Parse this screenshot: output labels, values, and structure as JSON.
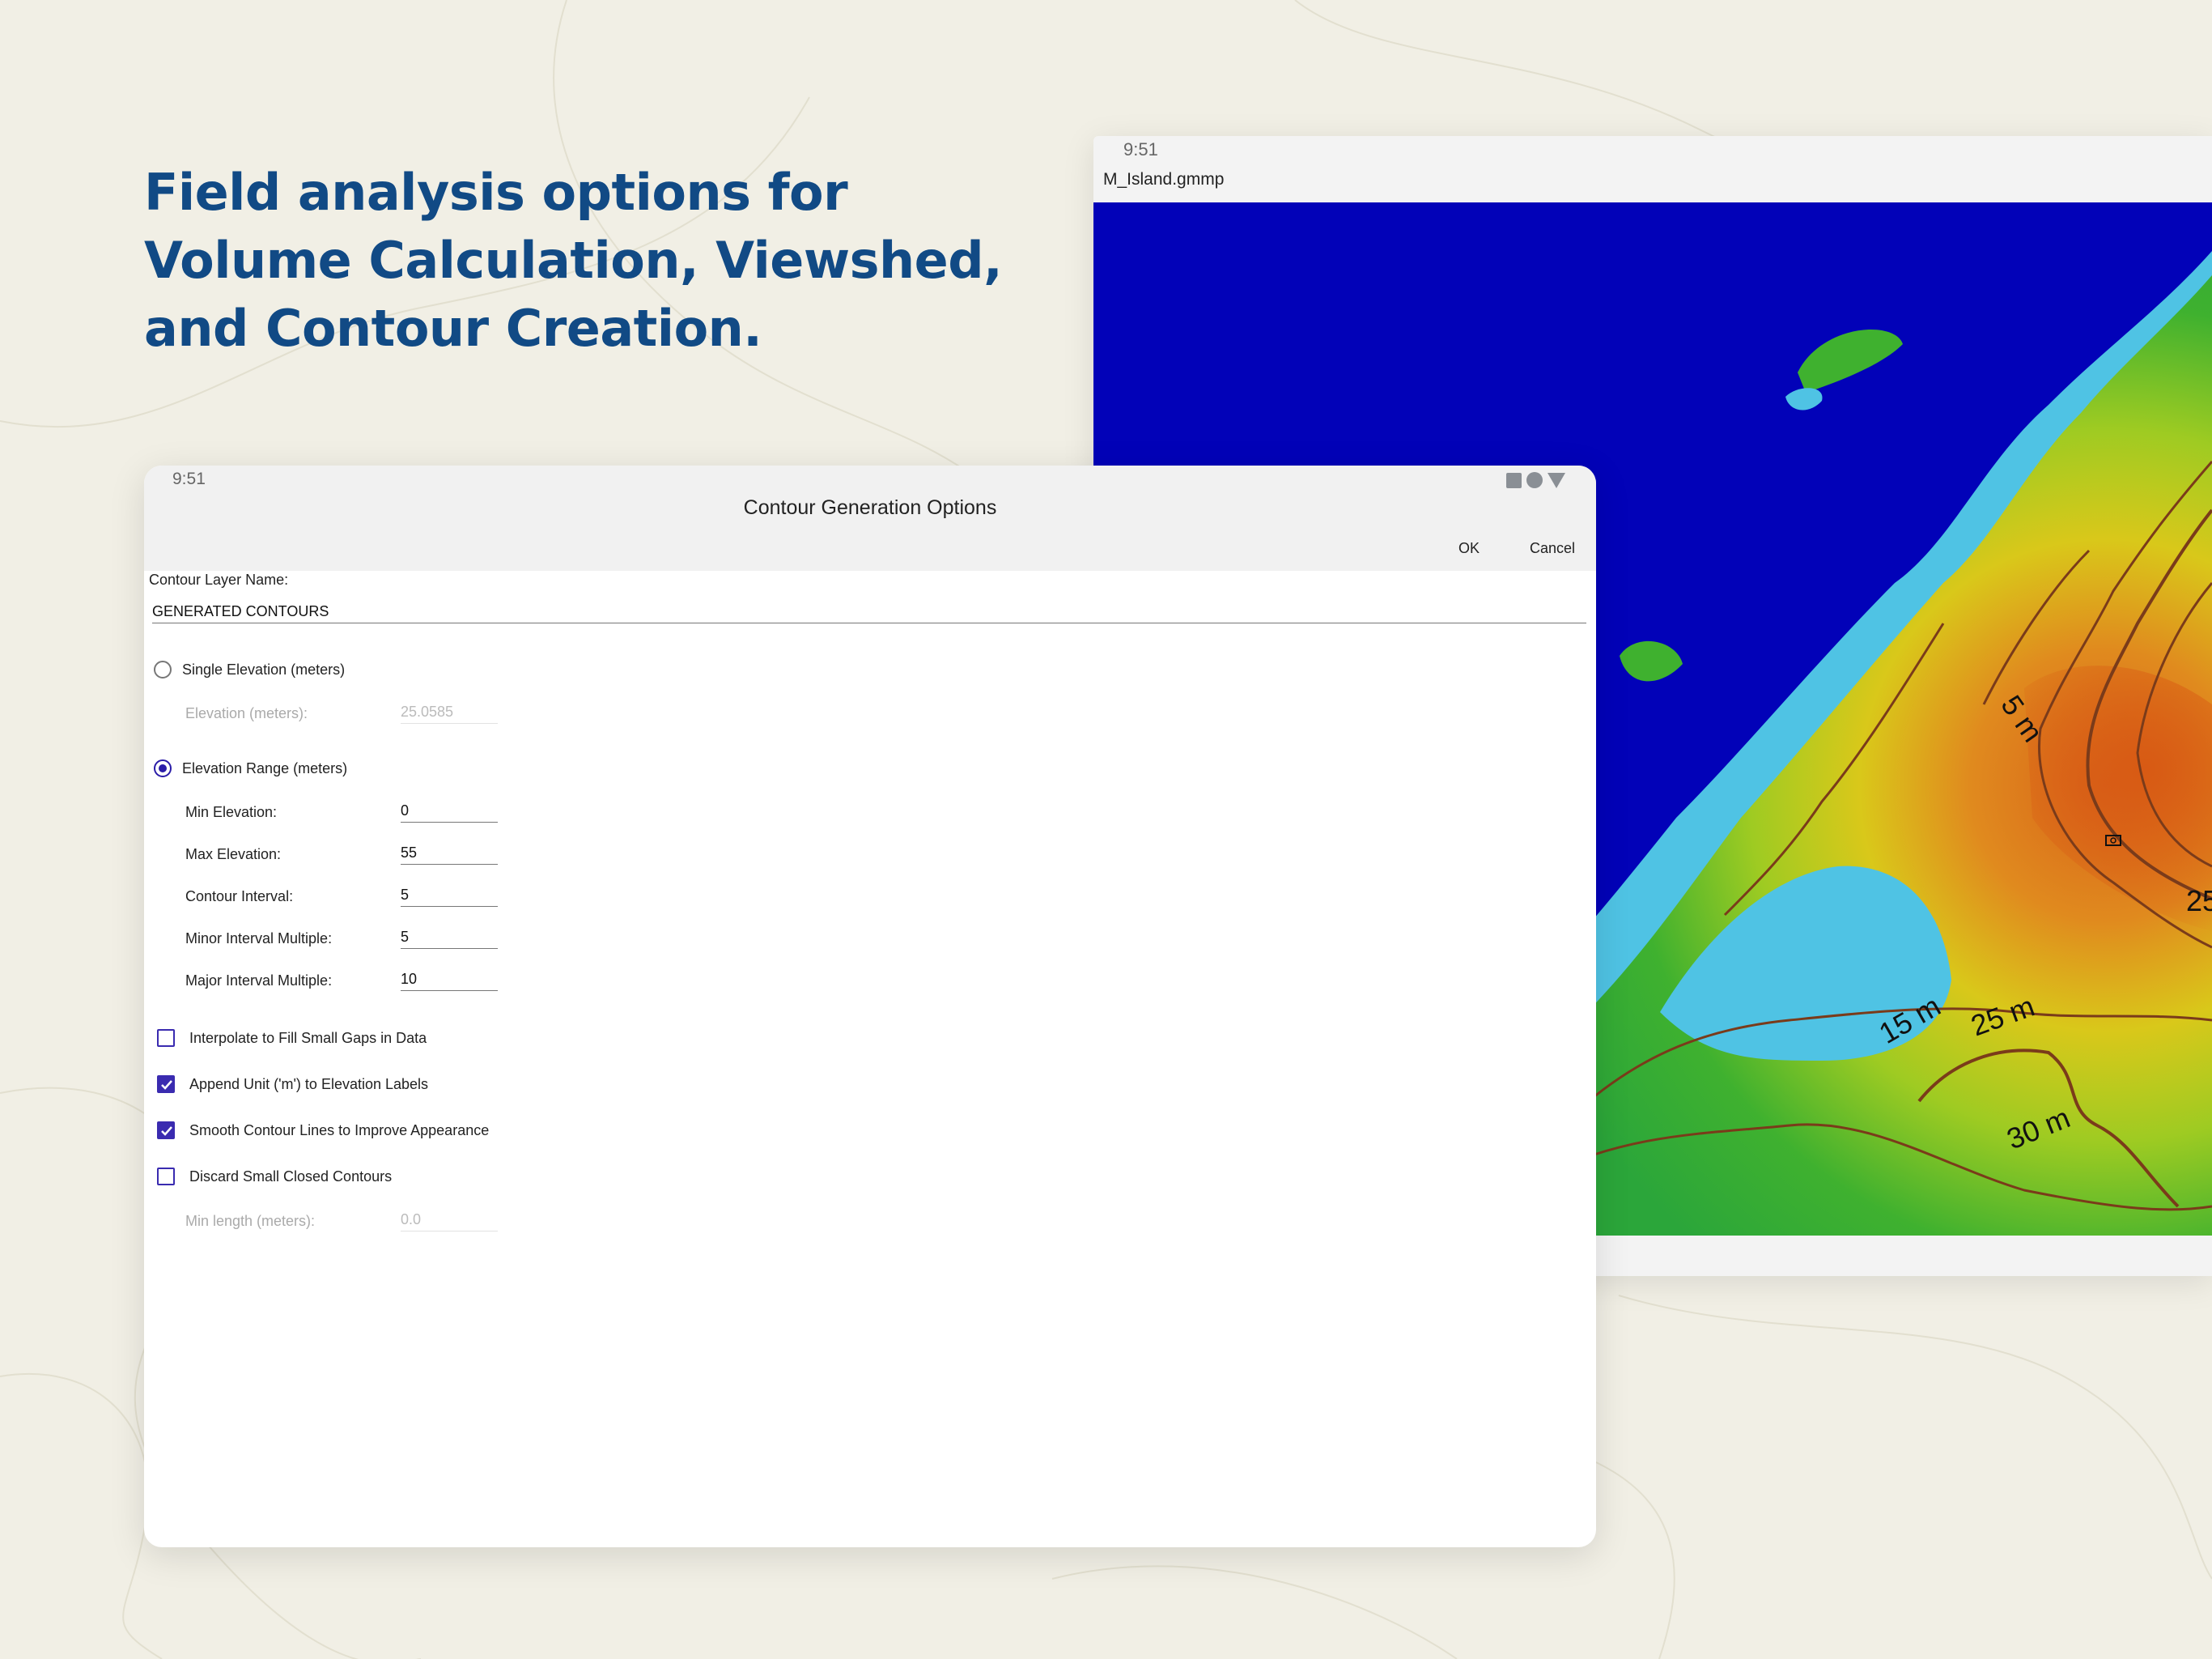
{
  "headline": {
    "line1": "Field analysis options for",
    "line2": "Volume Calculation, Viewshed,",
    "line3": "and Contour Creation."
  },
  "map_window": {
    "time": "9:51",
    "file_title": "M_Island.gmmp",
    "contour_labels": [
      "5 m",
      "15 m",
      "25 m",
      "30 m",
      "25"
    ],
    "colors": {
      "water": "#0202b8",
      "shallow": "#4fc3e4",
      "low": "#3fb12f",
      "mid": "#d9c81a",
      "high": "#d8641a",
      "contour": "#7a3b1a"
    }
  },
  "dialog": {
    "time": "9:51",
    "title": "Contour Generation Options",
    "ok_label": "OK",
    "cancel_label": "Cancel",
    "layer_name_label": "Contour Layer Name:",
    "layer_name_value": "GENERATED CONTOURS",
    "single_elevation": {
      "label": "Single Elevation (meters)",
      "selected": false
    },
    "elevation_label": "Elevation (meters):",
    "elevation_value": "25.0585",
    "elevation_range": {
      "label": "Elevation Range (meters)",
      "selected": true
    },
    "fields": {
      "min_label": "Min Elevation:",
      "min_value": "0",
      "max_label": "Max Elevation:",
      "max_value": "55",
      "interval_label": "Contour Interval:",
      "interval_value": "5",
      "minor_label": "Minor Interval Multiple:",
      "minor_value": "5",
      "major_label": "Major Interval Multiple:",
      "major_value": "10"
    },
    "options": {
      "interpolate": {
        "label": "Interpolate to Fill Small Gaps in Data",
        "checked": false
      },
      "append_unit": {
        "label": "Append Unit ('m') to Elevation Labels",
        "checked": true
      },
      "smooth": {
        "label": "Smooth Contour Lines to Improve Appearance",
        "checked": true
      },
      "discard": {
        "label": "Discard Small Closed Contours",
        "checked": false
      }
    },
    "min_length_label": "Min length (meters):",
    "min_length_value": "0.0",
    "accent_color": "#3a2bb0"
  }
}
